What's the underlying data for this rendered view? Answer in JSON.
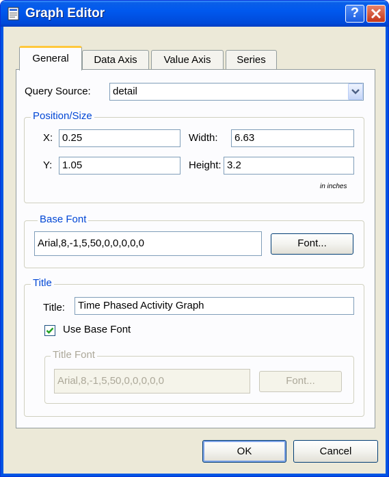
{
  "window": {
    "title": "Graph Editor",
    "help_label": "?"
  },
  "tabs": [
    {
      "label": "General",
      "active": true
    },
    {
      "label": "Data Axis",
      "active": false
    },
    {
      "label": "Value Axis",
      "active": false
    },
    {
      "label": "Series",
      "active": false
    }
  ],
  "general": {
    "query_source": {
      "label": "Query Source:",
      "value": "detail"
    },
    "position_size": {
      "legend": "Position/Size",
      "x_label": "X:",
      "x_value": "0.25",
      "y_label": "Y:",
      "y_value": "1.05",
      "width_label": "Width:",
      "width_value": "6.63",
      "height_label": "Height:",
      "height_value": "3.2",
      "units_note": "in inches"
    },
    "base_font": {
      "legend": "Base Font",
      "value": "Arial,8,-1,5,50,0,0,0,0,0",
      "font_button": "Font..."
    },
    "title_group": {
      "legend": "Title",
      "title_label": "Title:",
      "title_value": "Time Phased Activity Graph",
      "use_base_font_label": "Use Base Font",
      "use_base_font_checked": true,
      "title_font": {
        "legend": "Title Font",
        "value": "Arial,8,-1,5,50,0,0,0,0,0",
        "font_button": "Font...",
        "disabled": true
      }
    }
  },
  "buttons": {
    "ok": "OK",
    "cancel": "Cancel"
  },
  "colors": {
    "titlebar": "#0058ee",
    "dialog_bg": "#ece9d8",
    "group_legend": "#0046d5",
    "tab_highlight": "#ffc83c",
    "disabled_text": "#aca899"
  }
}
